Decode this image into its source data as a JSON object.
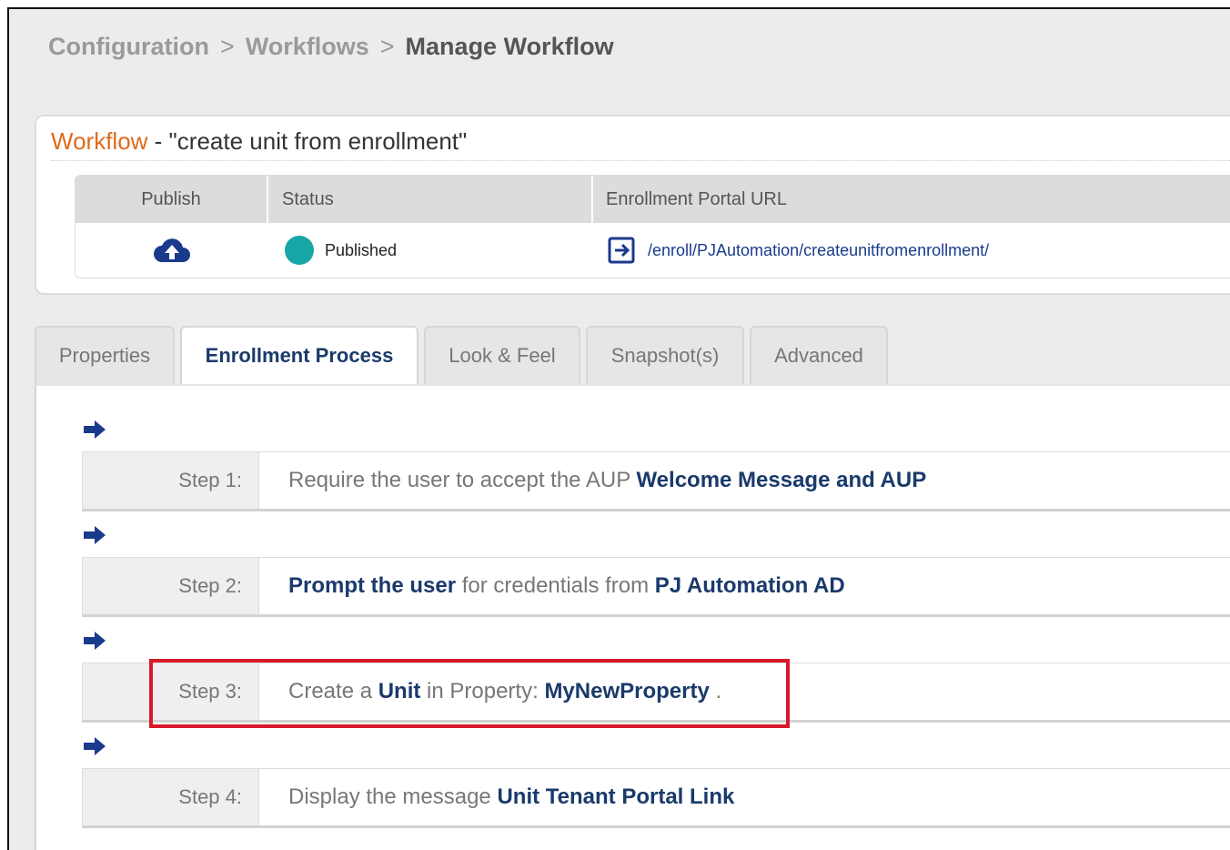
{
  "breadcrumb": {
    "item1": "Configuration",
    "item2": "Workflows",
    "current": "Manage Workflow",
    "separator": ">"
  },
  "workflow": {
    "label": "Workflow",
    "name": "- \"create unit from enrollment\""
  },
  "table": {
    "headers": {
      "publish": "Publish",
      "status": "Status",
      "url": "Enrollment Portal URL"
    },
    "status_text": "Published",
    "url_text": "/enroll/PJAutomation/createunitfromenrollment/",
    "status_color": "#17a6a6"
  },
  "tabs": [
    "Properties",
    "Enrollment Process",
    "Look & Feel",
    "Snapshot(s)",
    "Advanced"
  ],
  "active_tab": "Enrollment Process",
  "steps": [
    {
      "label": "Step 1:",
      "t1": "Require the user to accept the AUP ",
      "b1": "Welcome Message and AUP",
      "t2": "",
      "b2": "",
      "t3": ""
    },
    {
      "label": "Step 2:",
      "t1": "",
      "b1": "Prompt the user",
      "t2": " for credentials from ",
      "b2": "PJ Automation AD",
      "t3": ""
    },
    {
      "label": "Step 3:",
      "t1": "Create a ",
      "b1": "Unit",
      "t2": " in Property: ",
      "b2": "MyNewProperty",
      "t3": " ."
    },
    {
      "label": "Step 4:",
      "t1": "Display the message ",
      "b1": "Unit Tenant Portal Link",
      "t2": "",
      "b2": "",
      "t3": ""
    }
  ],
  "colors": {
    "accent": "#e06a1a",
    "link": "#1a3a6b",
    "highlight": "#d8192b",
    "arrow": "#1a3a8c"
  }
}
